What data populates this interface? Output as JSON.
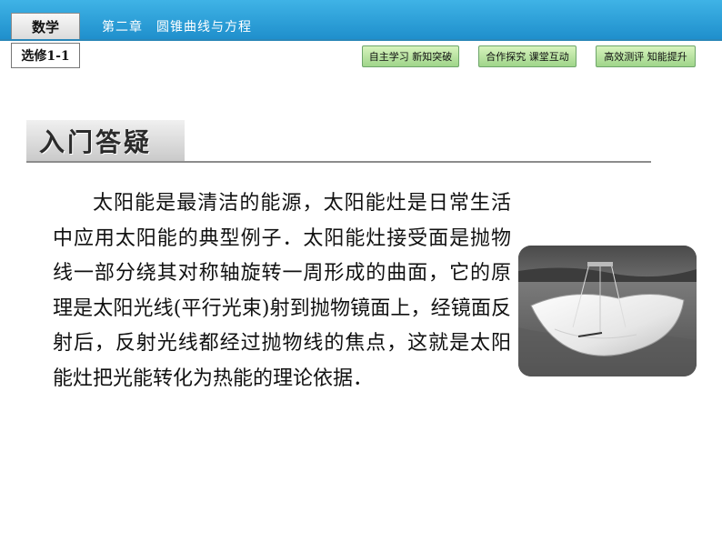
{
  "header": {
    "subject": "数学",
    "chapter": "第二章　圆锥曲线与方程",
    "module": "选修1-1",
    "nav": [
      {
        "label": "自主学习  新知突破"
      },
      {
        "label": "合作探究  课堂互动"
      },
      {
        "label": "高效测评  知能提升"
      }
    ]
  },
  "section": {
    "title": "入门答疑"
  },
  "body": {
    "paragraph": "太阳能是最清洁的能源，太阳能灶是日常生活中应用太阳能的典型例子．太阳能灶接受面是抛物线一部分绕其对称轴旋转一周形成的曲面，它的原理是太阳光线(平行光束)射到抛物镜面上，经镜面反射后，反射光线都经过抛物线的焦点，这就是太阳能灶把光能转化为热能的理论依据．"
  },
  "colors": {
    "header_blue": "#2ea3dc",
    "nav_green": "#b8e3a2"
  }
}
